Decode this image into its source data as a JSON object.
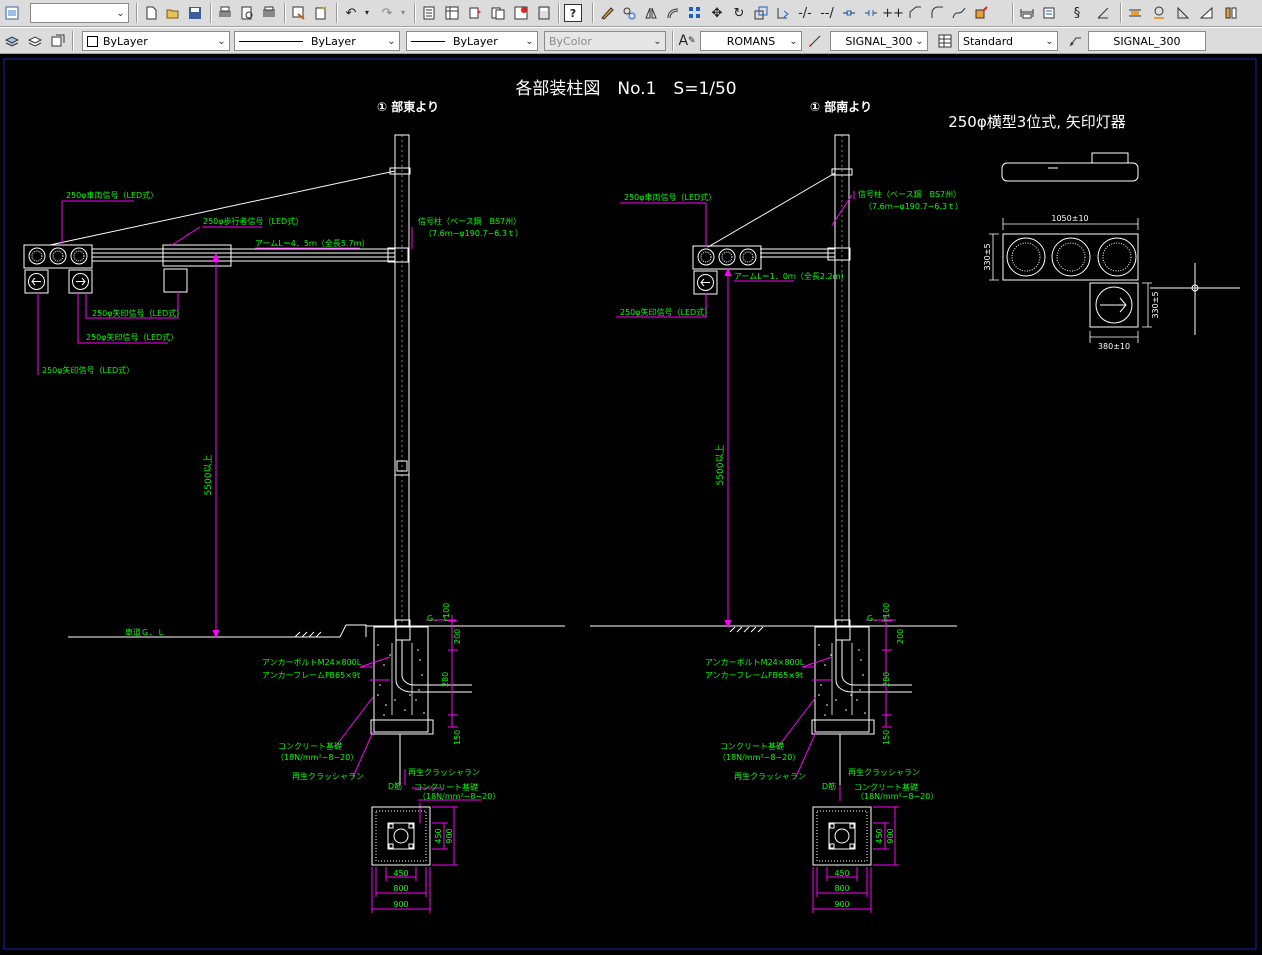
{
  "toolbar": {
    "search_value": "",
    "row1_icons": [
      "workspace-icon",
      "new-file-icon",
      "open-file-icon",
      "save-icon",
      "print-icon",
      "print-preview-icon",
      "publish-icon",
      "match-properties-icon",
      "paste-special-icon",
      "undo-icon",
      "undo-dropdown-icon",
      "redo-icon",
      "redo-dropdown-icon",
      "properties-icon",
      "design-center-icon",
      "tool-palettes-icon",
      "sheet-set-icon",
      "markup-icon",
      "calculator-icon",
      "help-icon",
      "erase-icon",
      "copy-object-icon",
      "mirror-icon",
      "offset-icon",
      "array-icon",
      "move-icon",
      "rotate-icon",
      "scale-icon",
      "stretch-icon",
      "trim-icon",
      "extend-icon",
      "break-at-point-icon",
      "break-icon",
      "join-icon",
      "chamfer-icon",
      "fillet-icon",
      "blend-icon",
      "explode-icon",
      "dim-linear-icon",
      "dim-aligned-icon",
      "dim-arc-icon",
      "dim-ordinate-icon",
      "dim-radius-icon",
      "dim-jogged-icon",
      "dim-diameter-icon",
      "dim-angular-icon"
    ],
    "help_glyph": "?",
    "row2_icons": [
      "layer-properties-icon",
      "layer-state-icon",
      "layer-previous-icon"
    ],
    "layer_value": "ByLayer",
    "linetype_value": "ByLayer",
    "lineweight_value": "ByLayer",
    "color_value": "ByColor",
    "text_style_value": "ROMANS",
    "dim_style_value": "SIGNAL_300",
    "table_style_value": "Standard",
    "multileader_style_value": "SIGNAL_300"
  },
  "drawing": {
    "title": "各部装柱図　No.1　S=1/50",
    "view_left_title": "① 部東より",
    "view_right_title": "① 部南より",
    "detail_title": "250φ横型3位式, 矢印灯器",
    "left": {
      "label_vehicle_signal": "250φ車両信号（LED式）",
      "label_ped_signal": "250φ歩行者信号（LED式）",
      "label_arm": "アームL＝4．5ｍ（全長5.7ｍ）",
      "label_pole": "信号柱（ベース鋼　BS7州）",
      "label_pole_spec": "（7.6ｍ−φ190.7−6.3ｔ）",
      "label_arrow_1": "250φ矢印信号（LED式）",
      "label_arrow_2": "250φ矢印信号（LED式）",
      "label_arrow_3": "250φ矢印信号（LED式）",
      "height_dim": "5500以上",
      "ground_label": "車道Ｇ．Ｌ",
      "gl_label": "Ｇ．Ｌ"
    },
    "right": {
      "label_vehicle_signal": "250φ車両信号（LED式）",
      "label_pole": "信号柱（ベース鋼　BS7州）",
      "label_pole_spec": "（7.6ｍ−φ190.7−6.3ｔ）",
      "label_arm": "アームL＝1．0ｍ（全長2.2ｍ）",
      "label_arrow": "250φ矢印信号（LED式）",
      "height_dim": "5500以上",
      "gl_label": "Ｇ．Ｌ"
    },
    "foundation": {
      "anchor_bolt": "アンカーボルトM24×800L",
      "anchor_frame": "アンカーフレームFB65×9t",
      "concrete": "コンクリート基礎",
      "concrete_spec": "（18N/mm²−8−20）",
      "crusher_run": "再生クラッシャラン",
      "d_label": "D筋",
      "dims_v": [
        "100",
        "200",
        "280",
        "150"
      ],
      "plan_dims": [
        "450",
        "800",
        "900"
      ],
      "plan_side_dims": [
        "450",
        "900"
      ]
    },
    "detail": {
      "width_dim": "1050±10",
      "height_dim": "330±5",
      "arrow_w_dim": "380±10",
      "arrow_h_dim": "330±5"
    }
  },
  "colors": {
    "white": "#ffffff",
    "magenta": "#ff00ff",
    "green": "#00ff00",
    "frame": "#2020a0"
  }
}
